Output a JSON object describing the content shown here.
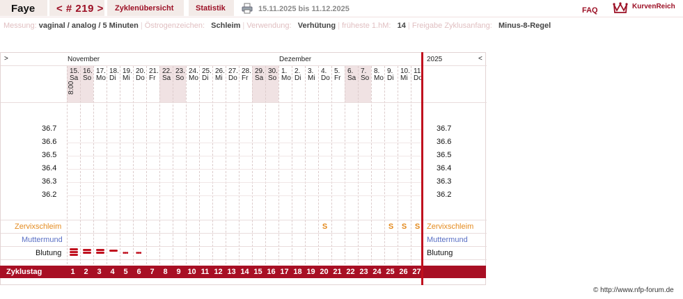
{
  "header": {
    "name": "Faye",
    "cycle_number": "< # 219 >",
    "tab_overview": "Zyklenübersicht",
    "tab_stats": "Statistik",
    "date_range": "15.11.2025 bis 11.12.2025",
    "faq": "FAQ",
    "logo": "KurvenReich"
  },
  "settings": [
    {
      "label": "Messung:",
      "value": "vaginal / analog / 5 Minuten"
    },
    {
      "label": "Östrogenzeichen:",
      "value": "Schleim"
    },
    {
      "label": "Verwendung:",
      "value": "Verhütung"
    },
    {
      "label": "früheste 1.hM:",
      "value": "14"
    },
    {
      "label": "Freigabe Zyklusanfang:",
      "value": "Minus-8-Regel"
    }
  ],
  "chart": {
    "nav_left": ">",
    "nav_right": "<",
    "month_1": "November",
    "month_2": "Dezember",
    "year": "2025",
    "time": "8:00",
    "temp_scale": [
      "36.7",
      "36.6",
      "36.5",
      "36.4",
      "36.3",
      "36.2"
    ],
    "row_cervix": "Zervixschleim",
    "row_cervix_pos": "Muttermund",
    "row_bleeding": "Blutung",
    "row_cycle_day": "Zyklustag",
    "mucus_symbol": "S",
    "colors": {
      "accent": "#9c1025",
      "cycle_bar": "#a80f24",
      "cervix": "#e48a1e",
      "muttermund": "#5a6fc4",
      "weekend": "#f0e2e3"
    }
  },
  "days": [
    {
      "d": "15.",
      "w": "Sa",
      "weekend": true,
      "cd": "1",
      "bleed": "heavy",
      "mucus": ""
    },
    {
      "d": "16.",
      "w": "So",
      "weekend": true,
      "cd": "2",
      "bleed": "medium",
      "mucus": ""
    },
    {
      "d": "17.",
      "w": "Mo",
      "weekend": false,
      "cd": "3",
      "bleed": "medium",
      "mucus": ""
    },
    {
      "d": "18.",
      "w": "Di",
      "weekend": false,
      "cd": "4",
      "bleed": "light",
      "mucus": ""
    },
    {
      "d": "19.",
      "w": "Mi",
      "weekend": false,
      "cd": "5",
      "bleed": "spotting",
      "mucus": ""
    },
    {
      "d": "20.",
      "w": "Do",
      "weekend": false,
      "cd": "6",
      "bleed": "spotting",
      "mucus": ""
    },
    {
      "d": "21.",
      "w": "Fr",
      "weekend": false,
      "cd": "7",
      "bleed": "",
      "mucus": ""
    },
    {
      "d": "22.",
      "w": "Sa",
      "weekend": true,
      "cd": "8",
      "bleed": "",
      "mucus": ""
    },
    {
      "d": "23.",
      "w": "So",
      "weekend": true,
      "cd": "9",
      "bleed": "",
      "mucus": ""
    },
    {
      "d": "24.",
      "w": "Mo",
      "weekend": false,
      "cd": "10",
      "bleed": "",
      "mucus": ""
    },
    {
      "d": "25.",
      "w": "Di",
      "weekend": false,
      "cd": "11",
      "bleed": "",
      "mucus": ""
    },
    {
      "d": "26.",
      "w": "Mi",
      "weekend": false,
      "cd": "12",
      "bleed": "",
      "mucus": ""
    },
    {
      "d": "27.",
      "w": "Do",
      "weekend": false,
      "cd": "13",
      "bleed": "",
      "mucus": ""
    },
    {
      "d": "28.",
      "w": "Fr",
      "weekend": false,
      "cd": "14",
      "bleed": "",
      "mucus": ""
    },
    {
      "d": "29.",
      "w": "Sa",
      "weekend": true,
      "cd": "15",
      "bleed": "",
      "mucus": ""
    },
    {
      "d": "30.",
      "w": "So",
      "weekend": true,
      "cd": "16",
      "bleed": "",
      "mucus": ""
    },
    {
      "d": "1.",
      "w": "Mo",
      "weekend": false,
      "cd": "17",
      "bleed": "",
      "mucus": ""
    },
    {
      "d": "2.",
      "w": "Di",
      "weekend": false,
      "cd": "18",
      "bleed": "",
      "mucus": ""
    },
    {
      "d": "3.",
      "w": "Mi",
      "weekend": false,
      "cd": "19",
      "bleed": "",
      "mucus": ""
    },
    {
      "d": "4.",
      "w": "Do",
      "weekend": false,
      "cd": "20",
      "bleed": "",
      "mucus": "S"
    },
    {
      "d": "5.",
      "w": "Fr",
      "weekend": false,
      "cd": "21",
      "bleed": "",
      "mucus": ""
    },
    {
      "d": "6.",
      "w": "Sa",
      "weekend": true,
      "cd": "22",
      "bleed": "",
      "mucus": ""
    },
    {
      "d": "7.",
      "w": "So",
      "weekend": true,
      "cd": "23",
      "bleed": "",
      "mucus": ""
    },
    {
      "d": "8.",
      "w": "Mo",
      "weekend": false,
      "cd": "24",
      "bleed": "",
      "mucus": ""
    },
    {
      "d": "9.",
      "w": "Di",
      "weekend": false,
      "cd": "25",
      "bleed": "",
      "mucus": "S"
    },
    {
      "d": "10.",
      "w": "Mi",
      "weekend": false,
      "cd": "26",
      "bleed": "",
      "mucus": "S"
    },
    {
      "d": "11.",
      "w": "Do",
      "weekend": false,
      "cd": "27",
      "bleed": "",
      "mucus": "S"
    }
  ],
  "footer": {
    "copyright": "© http://www.nfp-forum.de"
  }
}
